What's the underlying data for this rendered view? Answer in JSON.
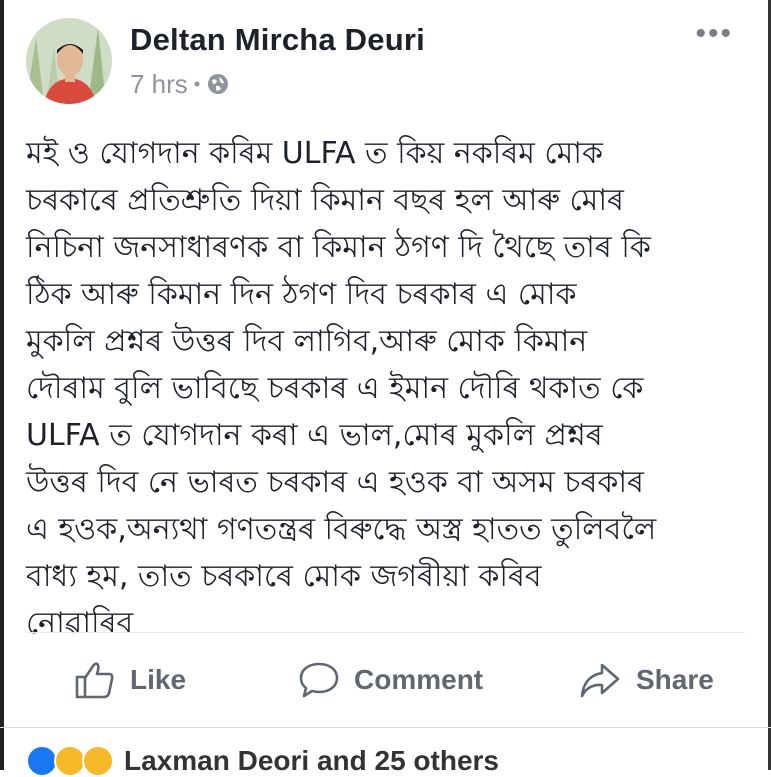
{
  "post": {
    "author": "Deltan Mircha Deuri",
    "time": "7 hrs",
    "separator": "•",
    "privacy_icon": "globe-icon",
    "more_icon": "more-options-icon",
    "text": "মই ও যোগদান কৰিম ULFA ত কিয় নকৰিম মোক\nচৰকাৰে প্ৰতিশ্ৰুতি দিয়া কিমান বছৰ হল আৰু মোৰ\nনিচিনা জনসাধাৰণক বা কিমান ঠগণ দি থৈছে তাৰ কি\nঠিক আৰু কিমান দিন ঠগণ দিব চৰকাৰ এ মোক\nমুকলি প্ৰশ্নৰ উত্তৰ দিব লাগিব,আৰু মোক কিমান\nদৌৰাম বুলি ভাবিছে চৰকাৰ এ ইমান দৌৰি থকাত কে\nULFA ত যোগদান কৰা এ ভাল,মোৰ মুকলি প্ৰশ্নৰ\nউত্তৰ দিব নে ভাৰত চৰকাৰ এ হওক বা অসম চৰকাৰ\nএ হওক,অন্যথা গণতন্ত্ৰৰ বিৰুদ্ধে অস্ত্ৰ হাতত তুলিবলৈ\nবাধ্য হম, তাত চৰকাৰে মোক জগৰীয়া কৰিব\nনোৱাৰিব"
  },
  "actions": {
    "like": "Like",
    "comment": "Comment",
    "share": "Share"
  },
  "reactions": {
    "summary": "Laxman Deori and 25 others",
    "icons": [
      "like-reaction-icon",
      "haha-reaction-icon",
      "wow-reaction-icon"
    ],
    "colors": {
      "like": "#1877f2",
      "haha": "#f7b928",
      "wow": "#f7b928"
    }
  }
}
